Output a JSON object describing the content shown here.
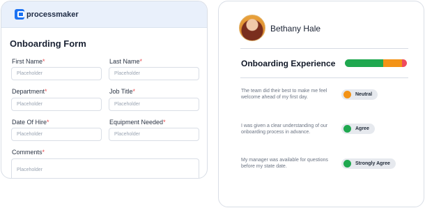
{
  "brand": {
    "name": "processmaker",
    "accent": "#1c72f2"
  },
  "form": {
    "title": "Onboarding Form",
    "required_mark": "*",
    "fields": {
      "first_name": {
        "label": "First Name",
        "placeholder": "Placeholder"
      },
      "last_name": {
        "label": "Last Name",
        "placeholder": "Placeholder"
      },
      "department": {
        "label": "Department",
        "placeholder": "Placeholder"
      },
      "job_title": {
        "label": "Job Title",
        "placeholder": "Placeholder"
      },
      "date_of_hire": {
        "label": "Date Of Hire",
        "placeholder": "Placeholder"
      },
      "equipment_needed": {
        "label": "Equipment Needed",
        "placeholder": "Placeholder"
      },
      "comments": {
        "label": "Comments",
        "placeholder": "Placeholder"
      }
    }
  },
  "profile": {
    "name": "Bethany Hale",
    "section_title": "Onboarding Experience",
    "sentiment_bar": [
      {
        "name": "green",
        "share": 0.62,
        "color": "#1fa84f"
      },
      {
        "name": "orange",
        "share": 0.3,
        "color": "#f39316"
      },
      {
        "name": "red",
        "share": 0.08,
        "color": "#ef4b5e"
      }
    ],
    "statements": [
      {
        "text": "The team did their best to make me feel welcome ahead of my first day.",
        "rating": "Neutral",
        "color": "#f39316"
      },
      {
        "text": "I was given a clear understanding of our onboarding process in advance.",
        "rating": "Agree",
        "color": "#1fa84f"
      },
      {
        "text": "My manager was available for questions before my state date.",
        "rating": "Strongly Agree",
        "color": "#1fa84f"
      }
    ]
  }
}
